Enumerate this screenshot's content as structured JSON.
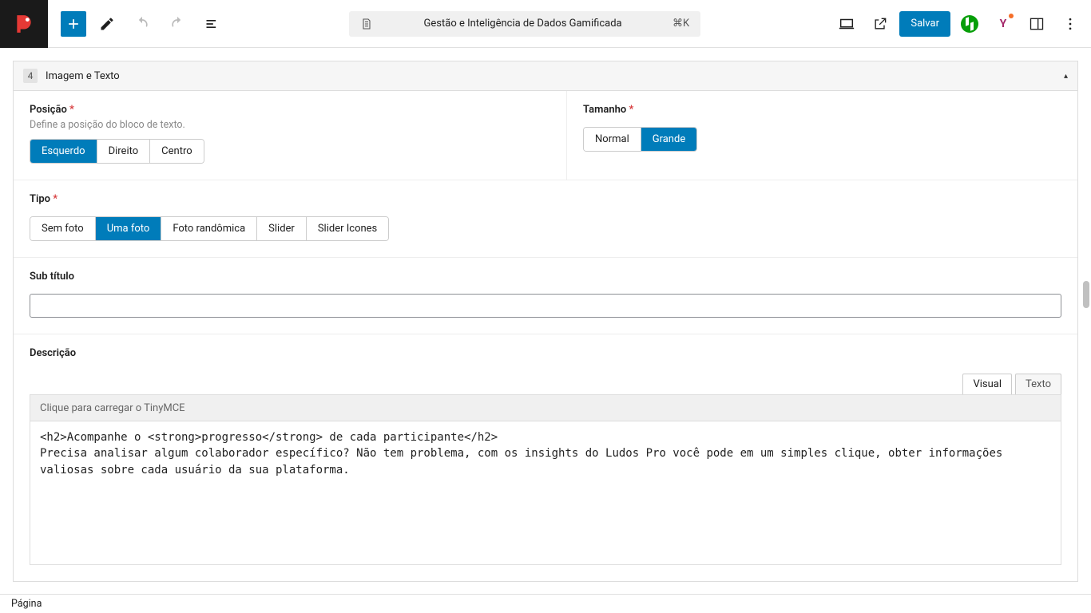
{
  "toolbar": {
    "title": "Gestão e Inteligência de Dados Gamificada",
    "shortcut": "⌘K",
    "save_label": "Salvar"
  },
  "block": {
    "number": "4",
    "name": "Imagem e Texto"
  },
  "fields": {
    "posicao": {
      "label": "Posição",
      "desc": "Define a posição do bloco de texto.",
      "options": [
        "Esquerdo",
        "Direito",
        "Centro"
      ],
      "selected": "Esquerdo"
    },
    "tamanho": {
      "label": "Tamanho",
      "options": [
        "Normal",
        "Grande"
      ],
      "selected": "Grande"
    },
    "tipo": {
      "label": "Tipo",
      "options": [
        "Sem foto",
        "Uma foto",
        "Foto randômica",
        "Slider",
        "Slider Icones"
      ],
      "selected": "Uma foto"
    },
    "subtitulo": {
      "label": "Sub título",
      "value": ""
    },
    "descricao": {
      "label": "Descrição",
      "tabs": [
        "Visual",
        "Texto"
      ],
      "active_tab": "Visual",
      "placeholder_bar": "Clique para carregar o TinyMCE",
      "content": "<h2>Acompanhe o <strong>progresso</strong> de cada participante</h2>\nPrecisa analisar algum colaborador específico? Não tem problema, com os insights do Ludos Pro você pode em um simples clique, obter informações valiosas sobre cada usuário da sua plataforma."
    }
  },
  "footer": {
    "breadcrumb": "Página"
  }
}
